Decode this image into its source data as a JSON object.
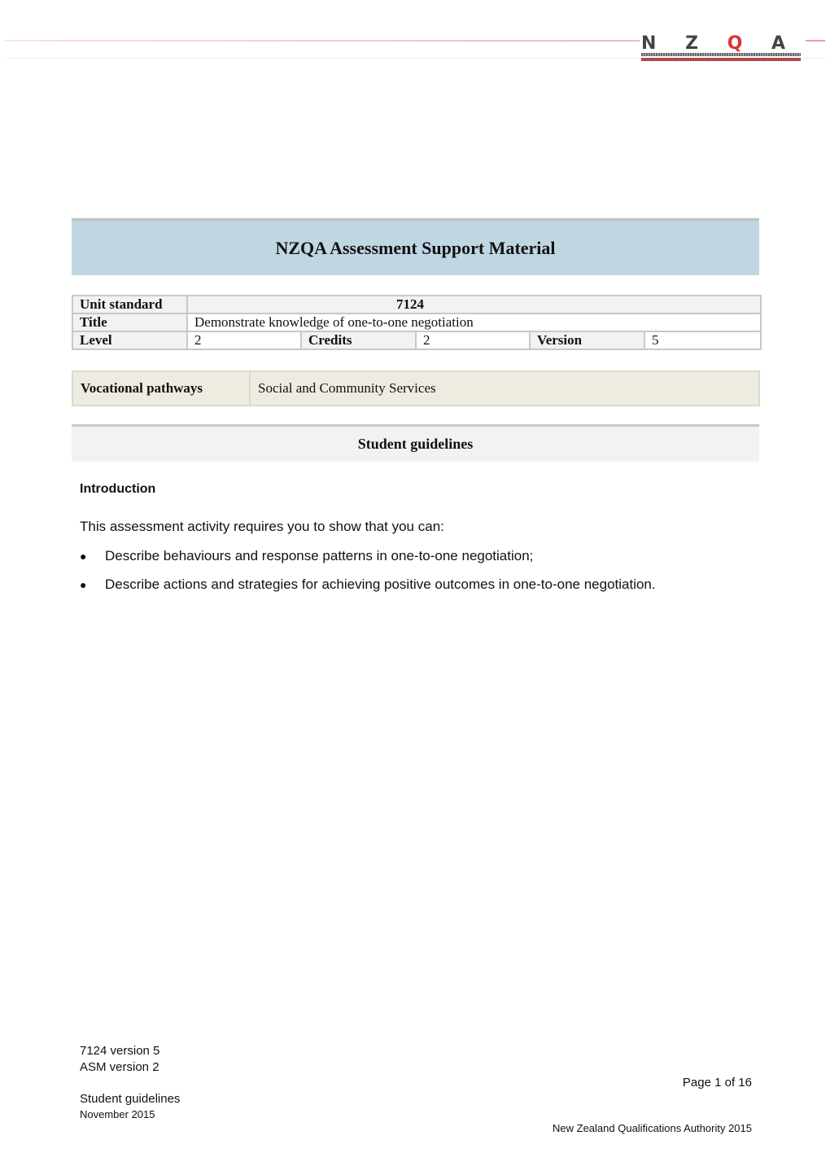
{
  "header": {
    "logo_text": "NZQA",
    "logo_accent_color": "#d33333"
  },
  "banner": {
    "title": "NZQA Assessment Support Material",
    "background_color": "#bfd6e3"
  },
  "info_table": {
    "unit_standard_label": "Unit standard",
    "unit_standard_value": "7124",
    "title_label": "Title",
    "title_value": "Demonstrate knowledge of one-to-one negotiation",
    "level_label": "Level",
    "level_value": "2",
    "credits_label": "Credits",
    "credits_value": "2",
    "version_label": "Version",
    "version_value": "5"
  },
  "vocational": {
    "label": "Vocational pathways",
    "value": "Social and Community Services"
  },
  "section": {
    "title": "Student guidelines"
  },
  "intro": {
    "heading": "Introduction",
    "lead": "This assessment activity requires you to show that you can:",
    "bullets": [
      "Describe behaviours and response patterns in one-to-one negotiation;",
      "Describe actions and strategies for achieving positive outcomes in one-to-one negotiation."
    ]
  },
  "footer": {
    "standard_version": "7124 version 5",
    "asm_version": "ASM version 2",
    "page": "Page 1 of 16",
    "doc_type": "Student guidelines",
    "date": "November 2015",
    "copyright": "New Zealand Qualifications Authority 2015"
  }
}
